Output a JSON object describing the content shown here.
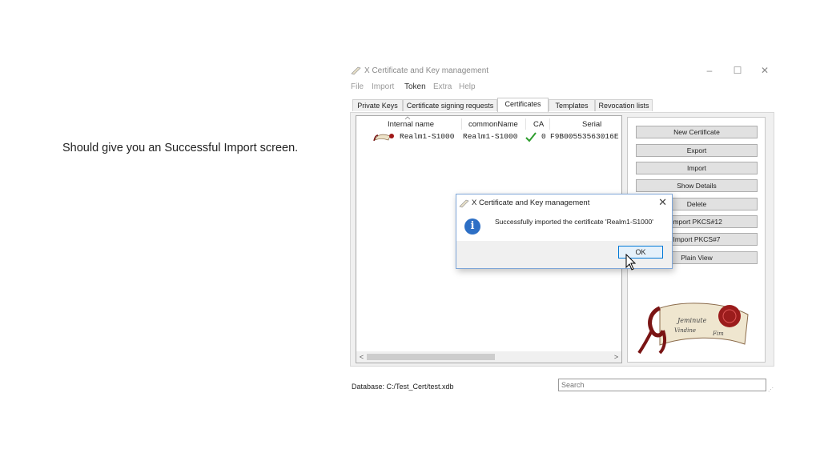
{
  "caption": "Should give you an Successful Import screen.",
  "window": {
    "title": "X Certificate and Key management",
    "controls": {
      "minimize": "–",
      "maximize": "☐",
      "close": "✕"
    },
    "menu": [
      "File",
      "Import",
      "Token",
      "Extra",
      "Help"
    ],
    "tabs": [
      "Private Keys",
      "Certificate signing requests",
      "Certificates",
      "Templates",
      "Revocation lists"
    ],
    "selected_tab": "Certificates",
    "table": {
      "columns": [
        "Internal name",
        "commonName",
        "CA",
        "Serial"
      ],
      "rows": [
        {
          "internal_name": "Realm1-S1000",
          "common_name": "Realm1-S1000",
          "ca_count": "0",
          "serial": "F9B00553563016E"
        }
      ]
    },
    "buttons": [
      "New Certificate",
      "Export",
      "Import",
      "Show Details",
      "Delete",
      "Import PKCS#12",
      "Import PKCS#7",
      "Plain View"
    ],
    "logo_text": "Jeminute Vindine Fim",
    "status": {
      "database": "Database: C:/Test_Cert/test.xdb",
      "search_placeholder": "Search"
    }
  },
  "dialog": {
    "title": "X Certificate and Key management",
    "message": "Successfully imported the certificate 'Realm1-S1000'",
    "ok_label": "OK",
    "close_symbol": "✕",
    "info_symbol": "i"
  },
  "colors": {
    "accent": "#0078d7",
    "info": "#2d6fc5",
    "ca_check": "#2e9e2e",
    "seal": "#8b1a1a"
  }
}
